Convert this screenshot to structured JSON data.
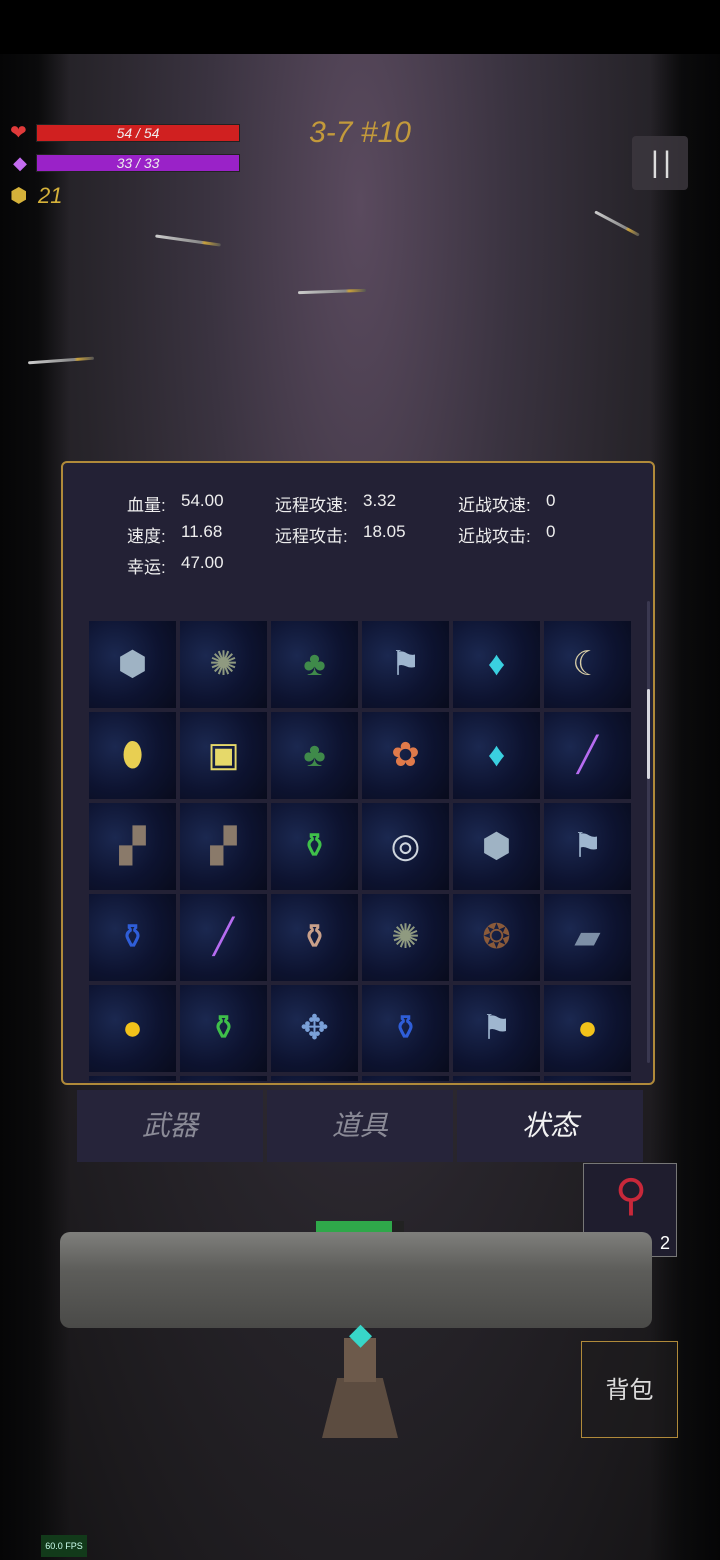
{
  "hud": {
    "hp_text": "54 / 54",
    "hp_fill": 1.0,
    "mana_text": "33 / 33",
    "mana_fill": 1.0,
    "gold": "21",
    "level": "3-7 #10",
    "pause_icon": "pause-icon"
  },
  "colors": {
    "hp": "#d02020",
    "mana": "#9a22c8",
    "gold": "#d6b23a",
    "level": "#c39a3b",
    "panel_border": "#b08a3a",
    "wall_health": "#2fa84a"
  },
  "stats_panel": {
    "stats": [
      {
        "label": "血量:",
        "value": "54.00"
      },
      {
        "label": "远程攻速:",
        "value": "3.32"
      },
      {
        "label": "近战攻速:",
        "value": "0"
      },
      {
        "label": "速度:",
        "value": "11.68"
      },
      {
        "label": "远程攻击:",
        "value": "18.05"
      },
      {
        "label": "近战攻击:",
        "value": "0"
      },
      {
        "label": "幸运:",
        "value": "47.00"
      }
    ],
    "inventory": [
      "rock-icon",
      "octopus-icon",
      "clover-icon",
      "flag-icon",
      "crystal-icon",
      "horn-icon",
      "gold-crystal-icon",
      "rune-card-icon",
      "clover-icon",
      "flower-wreath-icon",
      "crystal-icon",
      "wand-icon",
      "boots-icon",
      "boots-icon",
      "green-potion-icon",
      "ring-icon",
      "rock-icon",
      "flag-icon",
      "blue-potion-icon",
      "wand-icon",
      "vase-icon",
      "octopus-icon",
      "thorn-crown-icon",
      "book-icon",
      "gold-coin-icon",
      "green-potion-icon",
      "dragonfly-icon",
      "blue-potion-icon",
      "flag-icon",
      "gold-coin-icon"
    ],
    "scroll_fraction": 0.19
  },
  "tabs": [
    {
      "label": "武器",
      "active": false
    },
    {
      "label": "道具",
      "active": false
    },
    {
      "label": "状态",
      "active": true
    }
  ],
  "potion": {
    "icon": "red-potion-icon",
    "count": "2"
  },
  "wall": {
    "health_fill": 0.86
  },
  "bag_label": "背包",
  "fps": "60.0 FPS"
}
